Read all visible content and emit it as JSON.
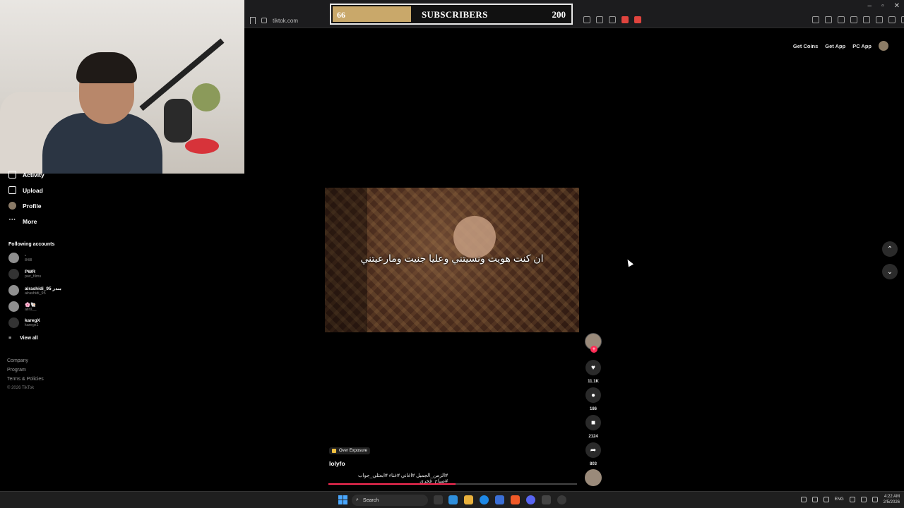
{
  "browser": {
    "url": "tiktok.com",
    "window_controls": [
      "–",
      "▫",
      "✕"
    ]
  },
  "overlay": {
    "current": "66",
    "title": "SUBSCRIBERS",
    "goal": "200",
    "progress": 0.33
  },
  "topbar": {
    "get_coins": "Get Coins",
    "get_app": "Get App",
    "pc_app": "PC App"
  },
  "sidebar": {
    "items": [
      {
        "label": "Activity",
        "icon": "bell-icon"
      },
      {
        "label": "Upload",
        "icon": "plus-square-icon"
      },
      {
        "label": "Profile",
        "icon": "avatar-icon"
      },
      {
        "label": "More",
        "icon": "dots-icon"
      }
    ],
    "following_title": "Following accounts",
    "following": [
      {
        "name": "·",
        "handle": "848l"
      },
      {
        "name": "PWR",
        "handle": "pwr_films"
      },
      {
        "name": "alrashidi_95 ﺑﻨﺪﺭ",
        "handle": "alrashidi_95"
      },
      {
        "name": "🌸🐚",
        "handle": "allr9__"
      },
      {
        "name": "karegX",
        "handle": "karegx1"
      }
    ],
    "view_all": "View all",
    "footer": [
      "Company",
      "Program",
      "Terms & Policies",
      "© 2026 TikTok"
    ]
  },
  "video": {
    "caption": "ان كنت هويت ونسيتني وعليا جنيت ومارعيتني",
    "sound": "Over Exposure",
    "username": "lolyfo",
    "hashtags": "#الزمن_الجميل #اغاني #غناء #ابعتلي_جواب #صباح_فخري",
    "progress": 0.51
  },
  "actions": {
    "likes": "11.1K",
    "comments": "186",
    "saves": "2124",
    "shares": "803"
  },
  "taskbar": {
    "search": "Search",
    "lang": "ENG",
    "time": "4:22 AM",
    "date": "2/5/2026"
  },
  "colors": {
    "accent": "#fe2c55",
    "overlay_fill": "#c9a86a",
    "background": "#000000"
  }
}
